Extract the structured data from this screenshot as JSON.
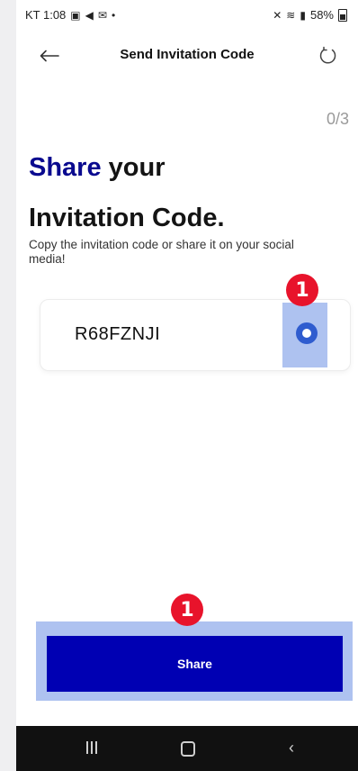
{
  "status_bar": {
    "time_text": "KT 1:08",
    "battery_text": "58%"
  },
  "header": {
    "title": "Send Invitation Code"
  },
  "progress_text": "0/3",
  "heading": {
    "accent": "Share",
    "line1_rest": " your",
    "line2": "Invitation Code."
  },
  "subtitle": "Copy the invitation code or share it on your social media!",
  "code": {
    "value": "R68FZNJI"
  },
  "badges": {
    "copy": "1",
    "share": "1"
  },
  "share_button": {
    "label": "Share"
  },
  "colors": {
    "accent": "#0a0a8f",
    "button": "#0000b3",
    "highlight": "#aec2f0",
    "badge": "#e8132b"
  }
}
